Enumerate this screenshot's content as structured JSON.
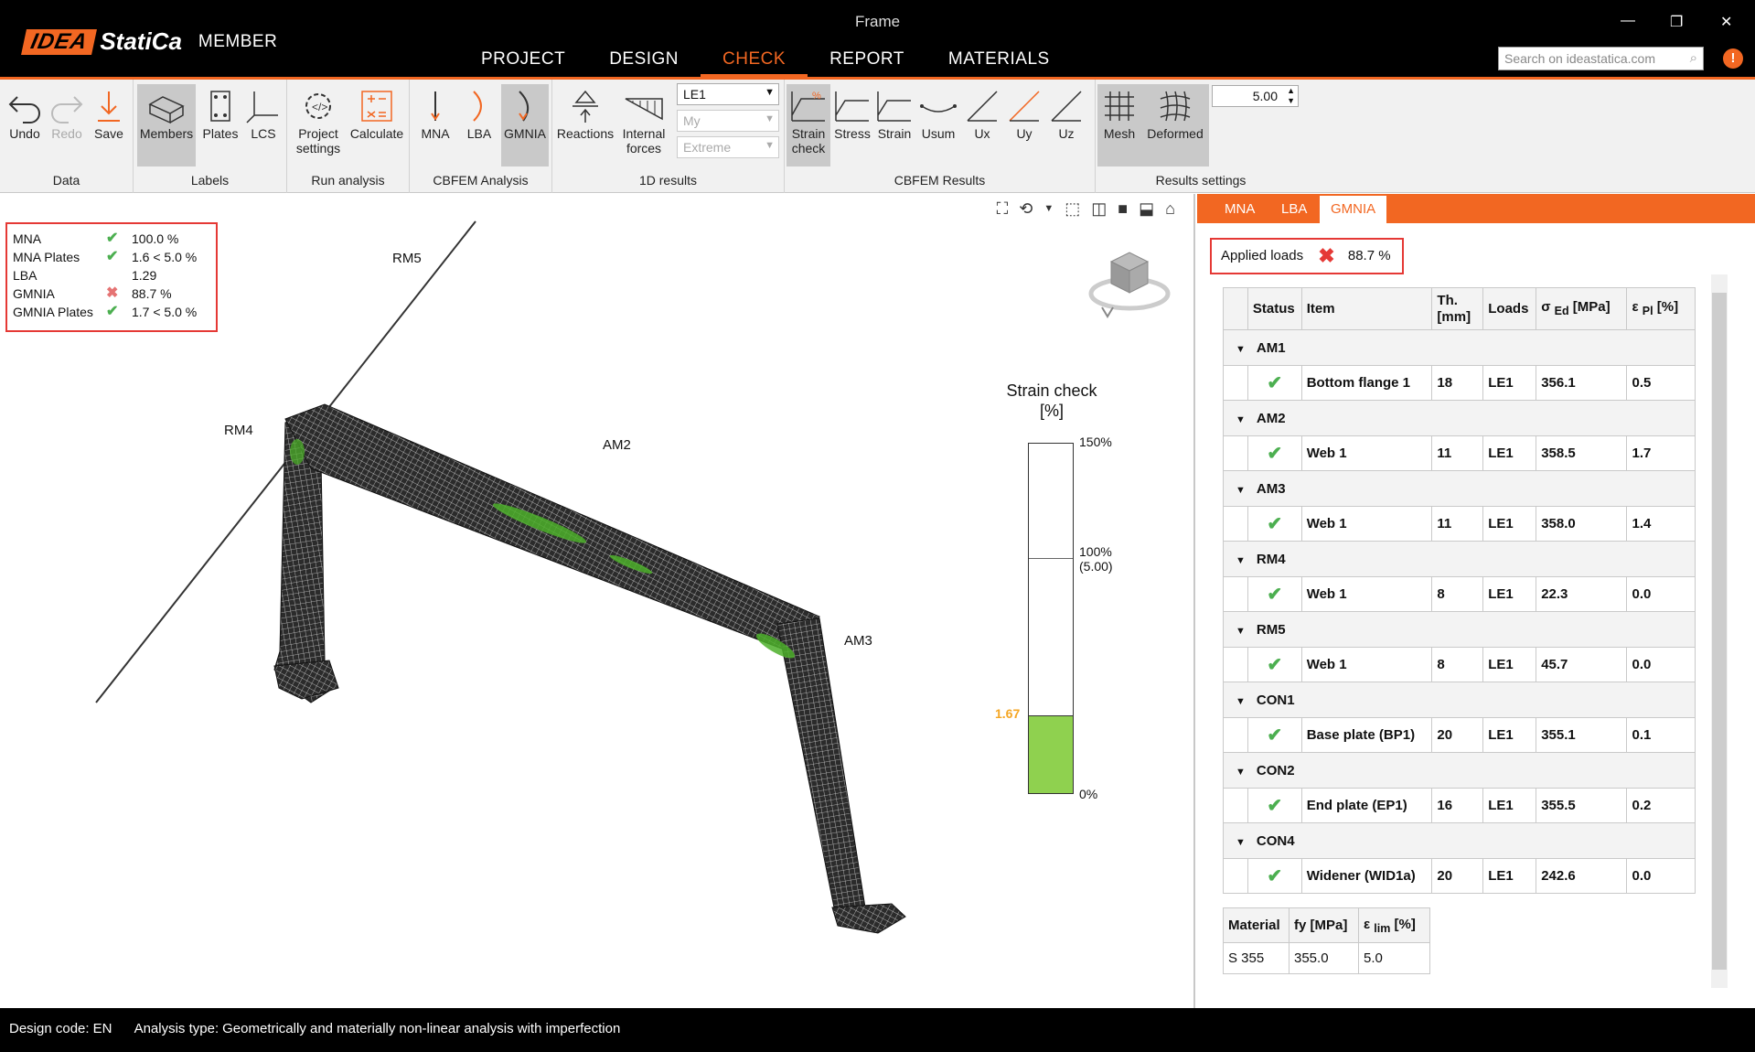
{
  "app": {
    "window_title": "Frame",
    "logo_idea": "IDEA",
    "logo_statica": "StatiCa",
    "product": "MEMBER"
  },
  "menu": [
    "PROJECT",
    "DESIGN",
    "CHECK",
    "REPORT",
    "MATERIALS"
  ],
  "search": {
    "placeholder": "Search on ideastatica.com"
  },
  "ribbon": {
    "data_group": {
      "label": "Data",
      "undo": "Undo",
      "redo": "Redo",
      "save": "Save"
    },
    "labels_group": {
      "label": "Labels",
      "members": "Members",
      "plates": "Plates",
      "lcs": "LCS"
    },
    "run_group": {
      "label": "Run analysis",
      "project_settings_1": "Project",
      "project_settings_2": "settings",
      "calculate": "Calculate"
    },
    "cbfem_analysis": {
      "label": "CBFEM Analysis",
      "mna": "MNA",
      "lba": "LBA",
      "gmnia": "GMNIA"
    },
    "results_1d": {
      "label": "1D results",
      "reactions": "Reactions",
      "internal_forces_1": "Internal",
      "internal_forces_2": "forces",
      "load_case": "LE1",
      "component": "My",
      "extreme": "Extreme"
    },
    "cbfem_results": {
      "label": "CBFEM Results",
      "strain_check_1": "Strain",
      "strain_check_2": "check",
      "stress": "Stress",
      "strain": "Strain",
      "usum": "Usum",
      "ux": "Ux",
      "uy": "Uy",
      "uz": "Uz"
    },
    "results_settings": {
      "label": "Results settings",
      "mesh": "Mesh",
      "deformed": "Deformed",
      "scale": "5.00"
    }
  },
  "viewport": {
    "summary": [
      {
        "name": "MNA",
        "status": "ok",
        "value": "100.0 %"
      },
      {
        "name": "MNA Plates",
        "status": "ok",
        "value": "1.6 < 5.0 %"
      },
      {
        "name": "LBA",
        "status": "none",
        "value": "1.29"
      },
      {
        "name": "GMNIA",
        "status": "fail",
        "value": "88.7 %"
      },
      {
        "name": "GMNIA Plates",
        "status": "ok",
        "value": "1.7 < 5.0 %"
      }
    ],
    "member_labels": [
      "RM5",
      "RM4",
      "AM2",
      "AM3"
    ],
    "legend": {
      "title_1": "Strain check",
      "title_2": "[%]",
      "tick_top": "150%",
      "tick_mid_1": "100%",
      "tick_mid_2": "(5.00)",
      "tick_bottom": "0%",
      "current_value": "1.67",
      "current_fraction": 0.223
    }
  },
  "panel": {
    "tabs": [
      "MNA",
      "LBA",
      "GMNIA"
    ],
    "active_tab": "GMNIA",
    "applied_loads_label": "Applied loads",
    "applied_loads_value": "88.7 %",
    "table_headers": {
      "status": "Status",
      "item": "Item",
      "th_1": "Th.",
      "th_2": "[mm]",
      "loads": "Loads",
      "sigma": "σ",
      "sigma_sub": "Ed",
      "sigma_unit": "[MPa]",
      "eps": "ε",
      "eps_sub": "Pl",
      "eps_unit": "[%]"
    },
    "groups": [
      {
        "name": "AM1",
        "rows": [
          {
            "item": "Bottom flange 1",
            "th": "18",
            "loads": "LE1",
            "sigma": "356.1",
            "eps": "0.5"
          }
        ]
      },
      {
        "name": "AM2",
        "rows": [
          {
            "item": "Web 1",
            "th": "11",
            "loads": "LE1",
            "sigma": "358.5",
            "eps": "1.7"
          }
        ]
      },
      {
        "name": "AM3",
        "rows": [
          {
            "item": "Web 1",
            "th": "11",
            "loads": "LE1",
            "sigma": "358.0",
            "eps": "1.4"
          }
        ]
      },
      {
        "name": "RM4",
        "rows": [
          {
            "item": "Web 1",
            "th": "8",
            "loads": "LE1",
            "sigma": "22.3",
            "eps": "0.0"
          }
        ]
      },
      {
        "name": "RM5",
        "rows": [
          {
            "item": "Web 1",
            "th": "8",
            "loads": "LE1",
            "sigma": "45.7",
            "eps": "0.0"
          }
        ]
      },
      {
        "name": "CON1",
        "rows": [
          {
            "item": "Base plate (BP1)",
            "th": "20",
            "loads": "LE1",
            "sigma": "355.1",
            "eps": "0.1"
          }
        ]
      },
      {
        "name": "CON2",
        "rows": [
          {
            "item": "End plate (EP1)",
            "th": "16",
            "loads": "LE1",
            "sigma": "355.5",
            "eps": "0.2"
          }
        ]
      },
      {
        "name": "CON4",
        "rows": [
          {
            "item": "Widener (WID1a)",
            "th": "20",
            "loads": "LE1",
            "sigma": "242.6",
            "eps": "0.0"
          }
        ]
      }
    ],
    "material": {
      "headers": {
        "material": "Material",
        "fy": "fy [MPa]",
        "eps": "ε",
        "eps_sub": "lim",
        "eps_unit": "[%]"
      },
      "row": {
        "material": "S 355",
        "fy": "355.0",
        "eps": "5.0"
      }
    }
  },
  "status_bar": {
    "design_code_label": "Design code:",
    "design_code": "EN",
    "analysis_label": "Analysis type:",
    "analysis": "Geometrically and materially non-linear analysis with imperfection"
  },
  "colors": {
    "accent": "#f26722",
    "ok": "#4caf50",
    "fail": "#e53935",
    "strain_fill": "#8fd14f"
  }
}
